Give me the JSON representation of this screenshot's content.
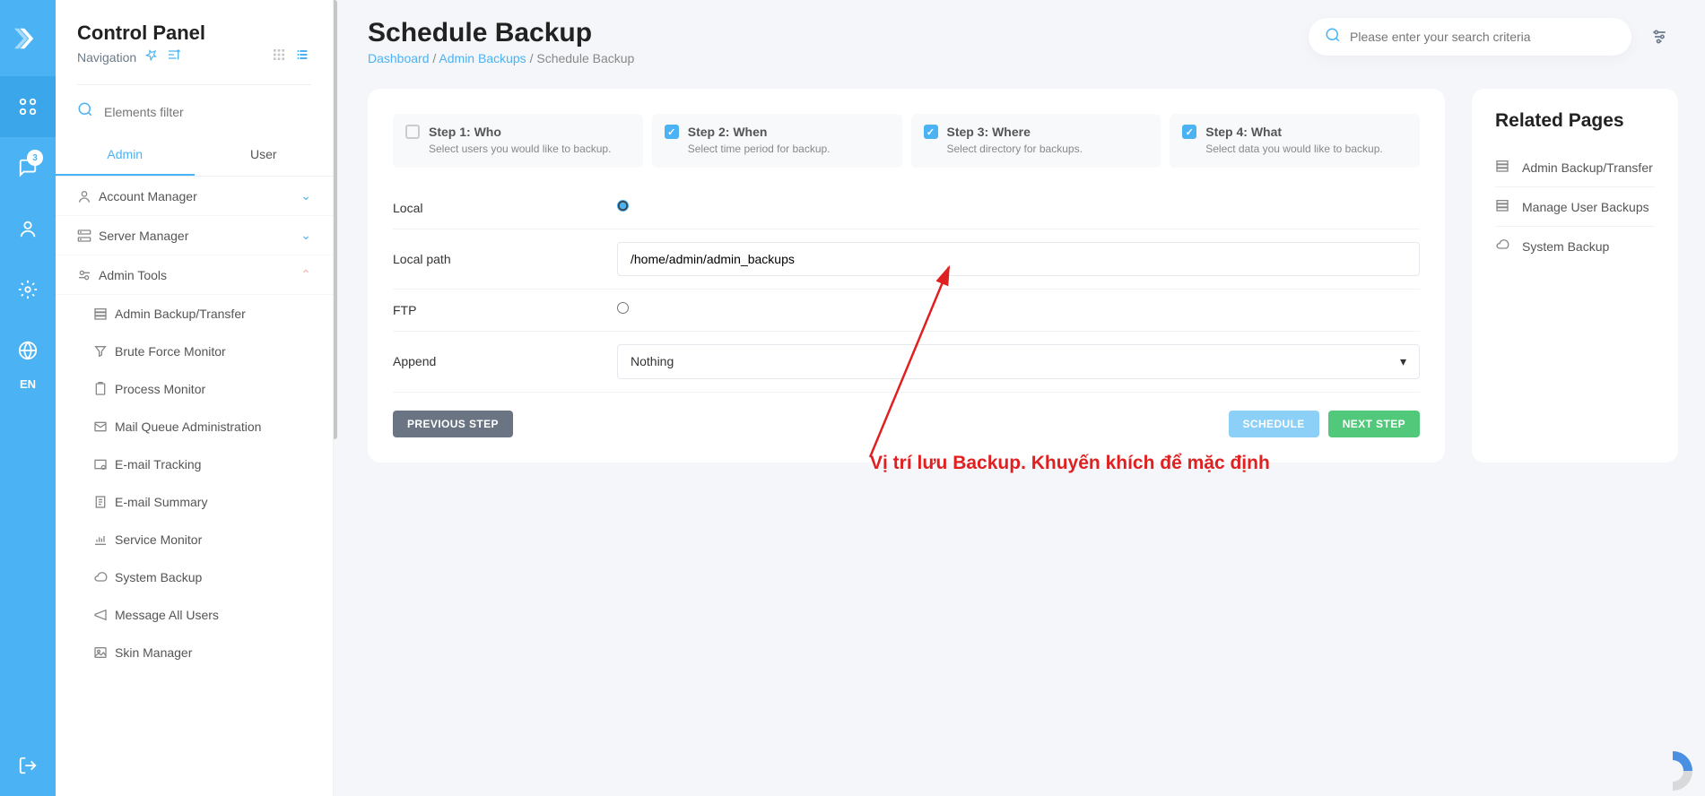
{
  "rail": {
    "msg_badge": "3",
    "lang": "EN"
  },
  "nav": {
    "title": "Control Panel",
    "subtitle": "Navigation",
    "filter_placeholder": "Elements filter",
    "tabs": {
      "admin": "Admin",
      "user": "User"
    },
    "sections": {
      "account": "Account Manager",
      "server": "Server Manager",
      "tools": "Admin Tools"
    },
    "tools_items": [
      "Admin Backup/Transfer",
      "Brute Force Monitor",
      "Process Monitor",
      "Mail Queue Administration",
      "E-mail Tracking",
      "E-mail Summary",
      "Service Monitor",
      "System Backup",
      "Message All Users",
      "Skin Manager"
    ]
  },
  "page": {
    "title": "Schedule Backup",
    "crumb1": "Dashboard",
    "crumb2": "Admin Backups",
    "crumb3": "Schedule Backup",
    "search_placeholder": "Please enter your search criteria"
  },
  "steps": [
    {
      "title": "Step 1: Who",
      "desc": "Select users you would like to backup.",
      "checked": false
    },
    {
      "title": "Step 2: When",
      "desc": "Select time period for backup.",
      "checked": true
    },
    {
      "title": "Step 3: Where",
      "desc": "Select directory for backups.",
      "checked": true
    },
    {
      "title": "Step 4: What",
      "desc": "Select data you would like to backup.",
      "checked": true
    }
  ],
  "form": {
    "local_label": "Local",
    "local_path_label": "Local path",
    "local_path_value": "/home/admin/admin_backups",
    "ftp_label": "FTP",
    "append_label": "Append",
    "append_value": "Nothing"
  },
  "buttons": {
    "prev": "PREVIOUS STEP",
    "schedule": "SCHEDULE",
    "next": "NEXT STEP"
  },
  "annotation": "Vị trí lưu Backup. Khuyến khích để mặc định",
  "related": {
    "title": "Related Pages",
    "items": [
      "Admin Backup/Transfer",
      "Manage User Backups",
      "System Backup"
    ]
  }
}
